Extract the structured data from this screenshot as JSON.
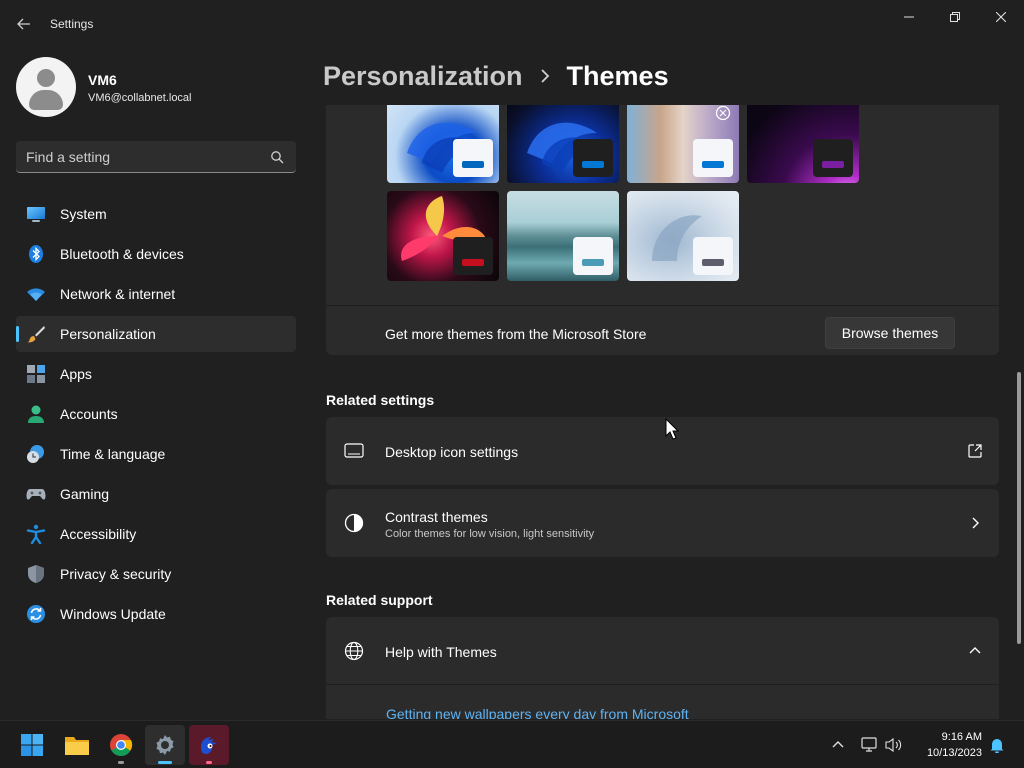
{
  "window": {
    "title": "Settings",
    "controls": {
      "minimize": "minimize-icon",
      "maximize": "maximize-icon",
      "close": "close-icon"
    }
  },
  "profile": {
    "name": "VM6",
    "email": "VM6@collabnet.local"
  },
  "search": {
    "placeholder": "Find a setting"
  },
  "sidebar": {
    "items": [
      {
        "label": "System",
        "icon": "system-icon"
      },
      {
        "label": "Bluetooth & devices",
        "icon": "bluetooth-icon"
      },
      {
        "label": "Network & internet",
        "icon": "wifi-icon"
      },
      {
        "label": "Personalization",
        "icon": "brush-icon",
        "selected": true
      },
      {
        "label": "Apps",
        "icon": "apps-icon"
      },
      {
        "label": "Accounts",
        "icon": "accounts-icon"
      },
      {
        "label": "Time & language",
        "icon": "clock-globe-icon"
      },
      {
        "label": "Gaming",
        "icon": "gamepad-icon"
      },
      {
        "label": "Accessibility",
        "icon": "accessibility-icon"
      },
      {
        "label": "Privacy & security",
        "icon": "shield-icon"
      },
      {
        "label": "Windows Update",
        "icon": "update-icon"
      }
    ]
  },
  "breadcrumb": {
    "parent": "Personalization",
    "current": "Themes"
  },
  "themes": {
    "store_text": "Get more themes from the Microsoft Store",
    "browse_label": "Browse themes",
    "tiles": [
      {
        "name": "windows-light",
        "accent": "#0067c0"
      },
      {
        "name": "windows-dark",
        "accent": "#0078d4"
      },
      {
        "name": "spotlight",
        "accent": "#0078d4"
      },
      {
        "name": "glow",
        "accent": "#7a1fa2"
      },
      {
        "name": "captured-motion",
        "accent": "#c50f1f"
      },
      {
        "name": "sunrise-lake",
        "accent": "#4a9bb5"
      },
      {
        "name": "flow",
        "accent": "#5d5d6b"
      }
    ]
  },
  "related_settings": {
    "title": "Related settings",
    "desktop_icon": {
      "title": "Desktop icon settings",
      "icon": "monitor-icon",
      "action": "external-link-icon"
    },
    "contrast": {
      "title": "Contrast themes",
      "subtitle": "Color themes for low vision, light sensitivity",
      "icon": "contrast-icon",
      "action": "chevron-right-icon"
    }
  },
  "related_support": {
    "title": "Related support",
    "help": {
      "title": "Help with Themes",
      "icon": "globe-icon",
      "action": "chevron-up-icon"
    },
    "link": "Getting new wallpapers every day from Microsoft"
  },
  "taskbar": {
    "apps": [
      "windows-start-icon",
      "file-explorer-icon",
      "chrome-icon",
      "settings-icon",
      "sonic-game-icon"
    ],
    "tray": [
      "chevron-up-icon",
      "network-icon",
      "volume-icon",
      "notification-bell-icon"
    ],
    "time": "9:16 AM",
    "date": "10/13/2023"
  },
  "colors": {
    "accent": "#4cc2ff",
    "background": "#202020",
    "card": "#2b2b2b",
    "link": "#5fb2f2"
  }
}
